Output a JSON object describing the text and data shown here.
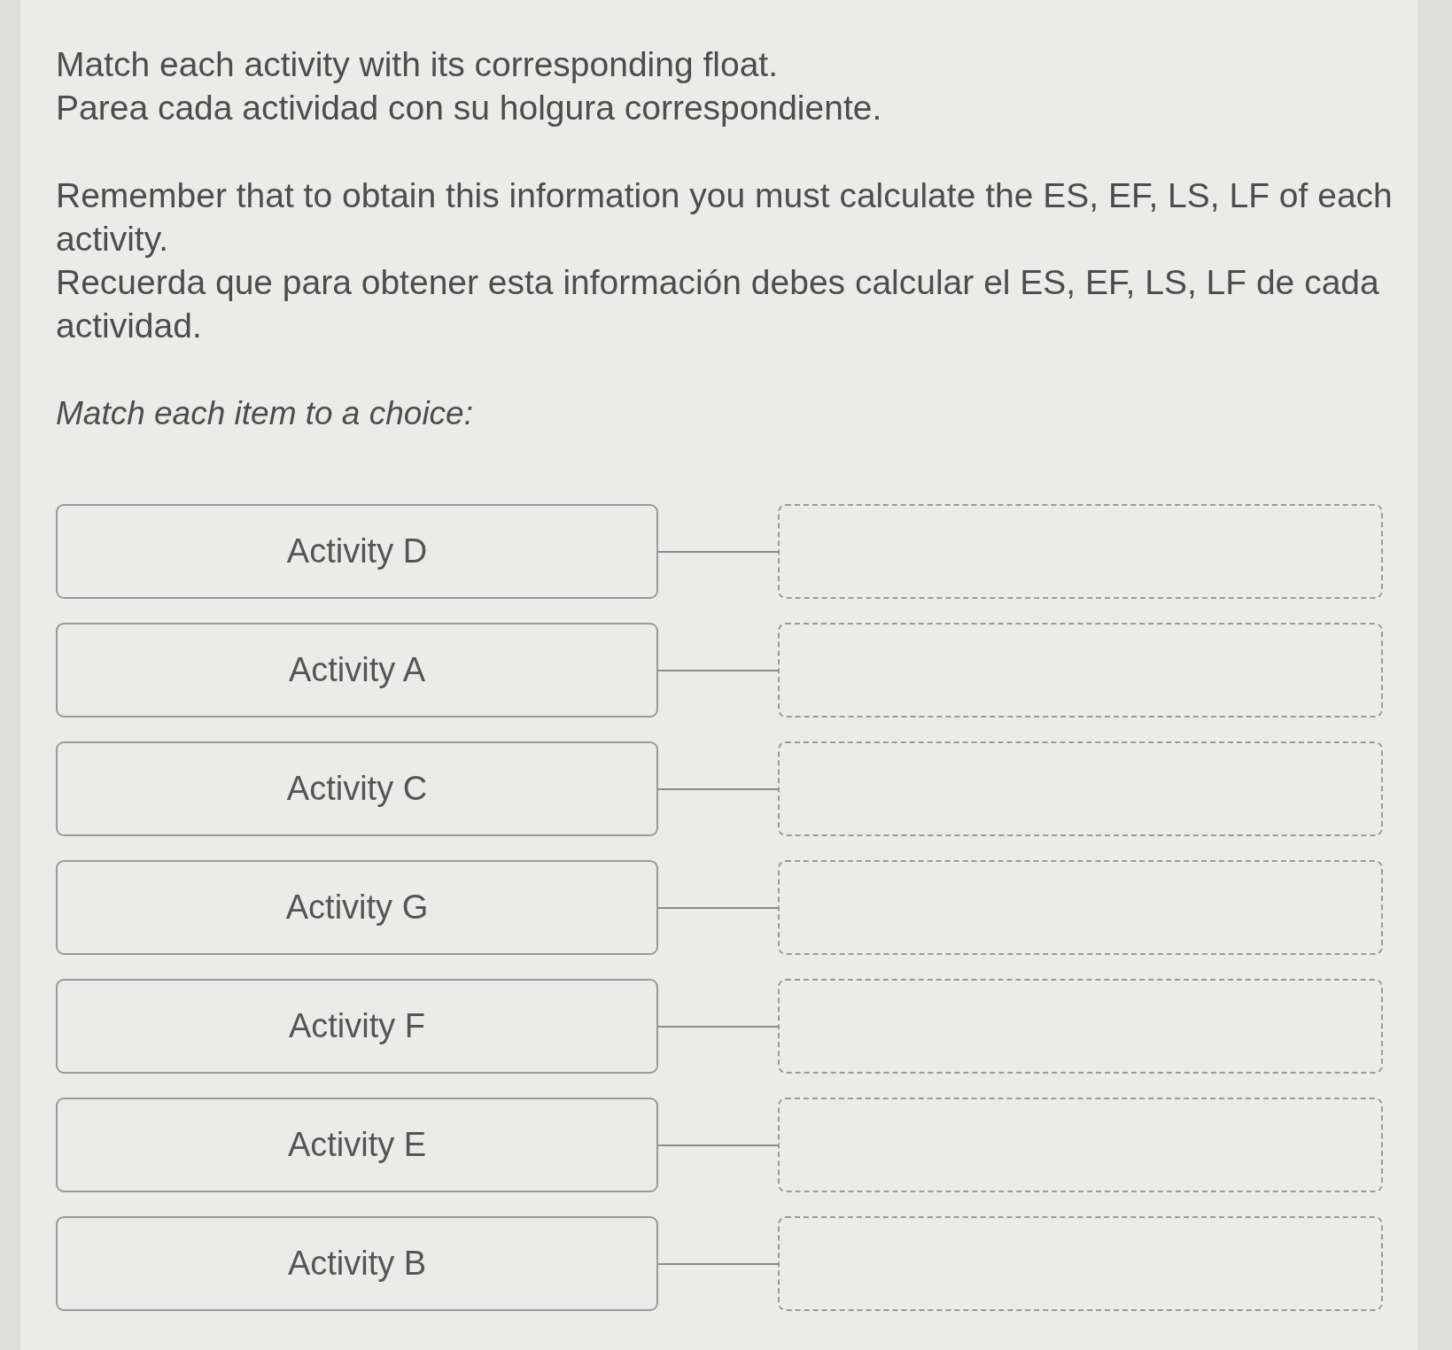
{
  "instructions": [
    [
      "Match each activity with its corresponding float.",
      "Parea cada actividad con su holgura correspondiente."
    ],
    [
      "Remember that to obtain this information you must calculate the ES, EF, LS, LF of each activity.",
      "Recuerda que para obtener esta información debes calcular el ES, EF, LS, LF de cada actividad."
    ]
  ],
  "prompt": "Match each item to a choice:",
  "items": [
    {
      "label": "Activity D"
    },
    {
      "label": "Activity A"
    },
    {
      "label": "Activity C"
    },
    {
      "label": "Activity G"
    },
    {
      "label": "Activity F"
    },
    {
      "label": "Activity E"
    },
    {
      "label": "Activity B"
    }
  ]
}
